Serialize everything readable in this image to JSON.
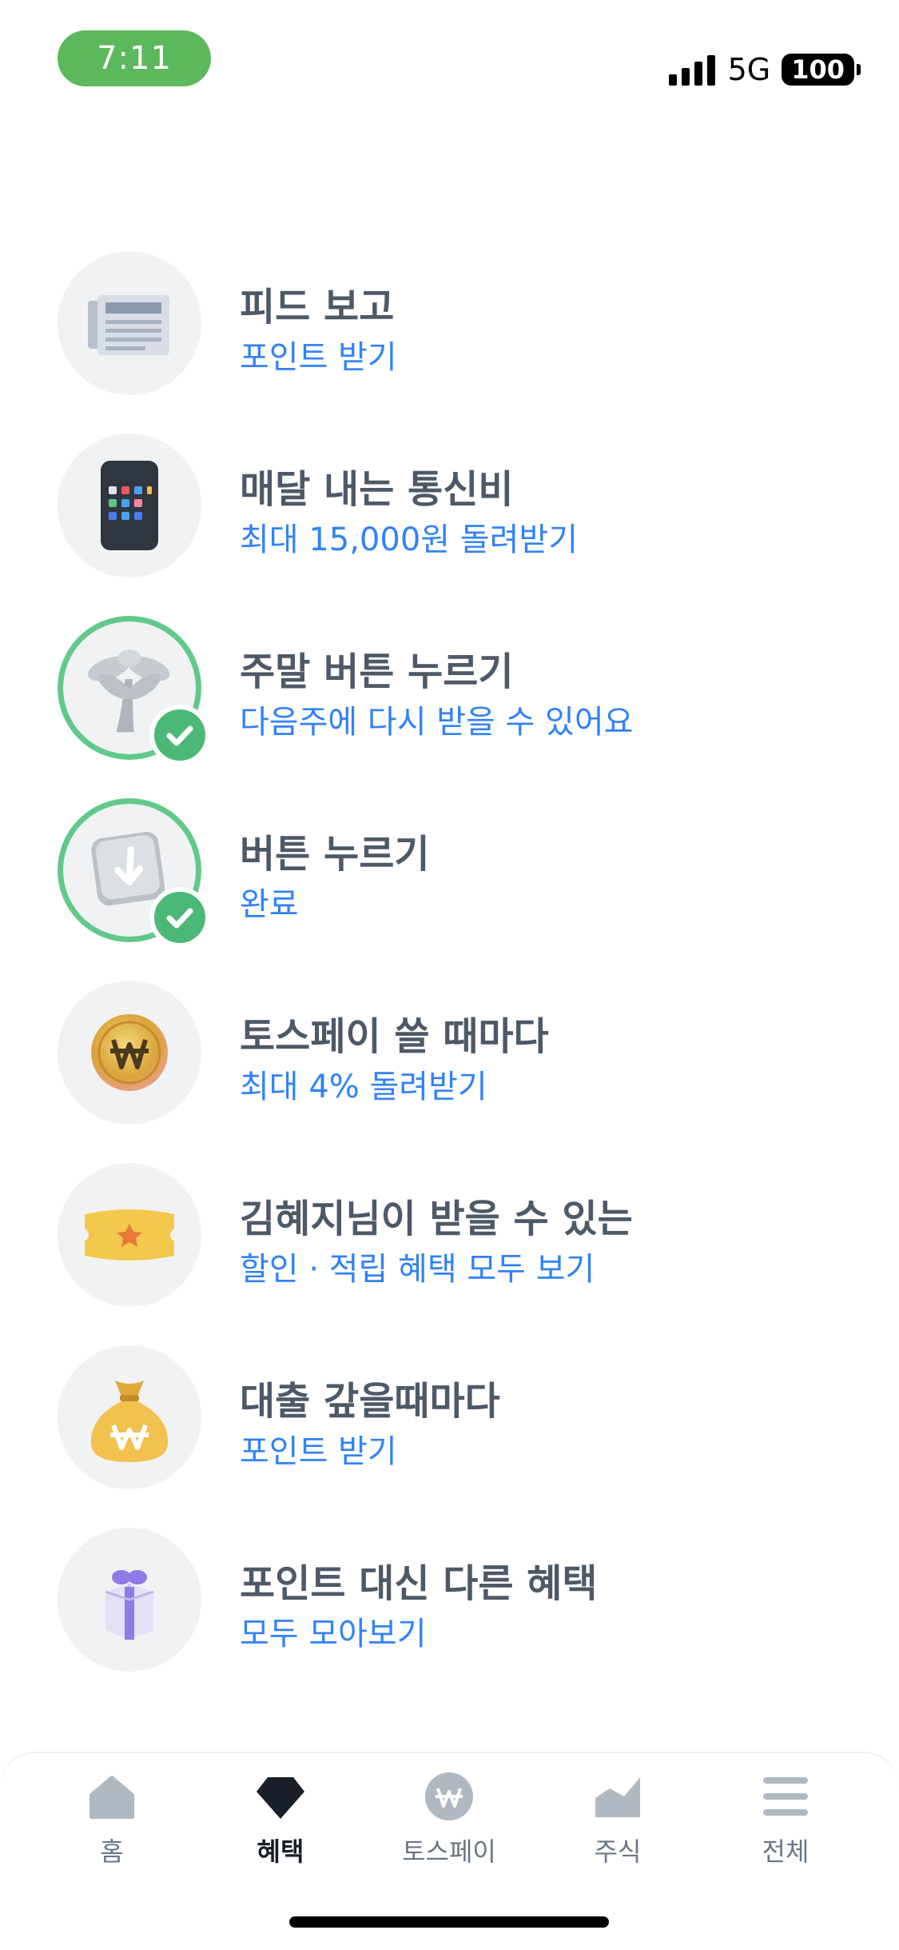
{
  "status_bar": {
    "time": "7:11",
    "network": "5G",
    "battery": "100"
  },
  "list": [
    {
      "title": "피드 보고",
      "subtitle": "포인트 받기",
      "icon": "newspaper-icon",
      "completed": false
    },
    {
      "title": "매달 내는 통신비",
      "subtitle": "최대 15,000원 돌려받기",
      "icon": "phone-icon",
      "completed": false
    },
    {
      "title": "주말 버튼 누르기",
      "subtitle": "다음주에 다시 받을 수 있어요",
      "icon": "palm-tree-icon",
      "completed": true
    },
    {
      "title": "버튼 누르기",
      "subtitle": "완료",
      "icon": "press-button-icon",
      "completed": true
    },
    {
      "title": "토스페이 쓸 때마다",
      "subtitle": "최대 4% 돌려받기",
      "icon": "won-coin-icon",
      "completed": false
    },
    {
      "title": "김혜지님이 받을 수 있는",
      "subtitle": "할인 · 적립 혜택 모두 보기",
      "icon": "ticket-icon",
      "completed": false
    },
    {
      "title": "대출 갚을때마다",
      "subtitle": "포인트 받기",
      "icon": "money-bag-icon",
      "completed": false
    },
    {
      "title": "포인트 대신 다른 혜택",
      "subtitle": "모두 모아보기",
      "icon": "gift-box-icon",
      "completed": false
    }
  ],
  "tabs": [
    {
      "label": "홈",
      "icon": "home-icon",
      "active": false
    },
    {
      "label": "혜택",
      "icon": "gem-icon",
      "active": true
    },
    {
      "label": "토스페이",
      "icon": "won-circle-icon",
      "active": false
    },
    {
      "label": "주식",
      "icon": "stock-chart-icon",
      "active": false
    },
    {
      "label": "전체",
      "icon": "menu-icon",
      "active": false
    }
  ],
  "colors": {
    "accent": "#3182f6",
    "check": "#4cb877",
    "status_time_bg": "#5cb85c"
  }
}
